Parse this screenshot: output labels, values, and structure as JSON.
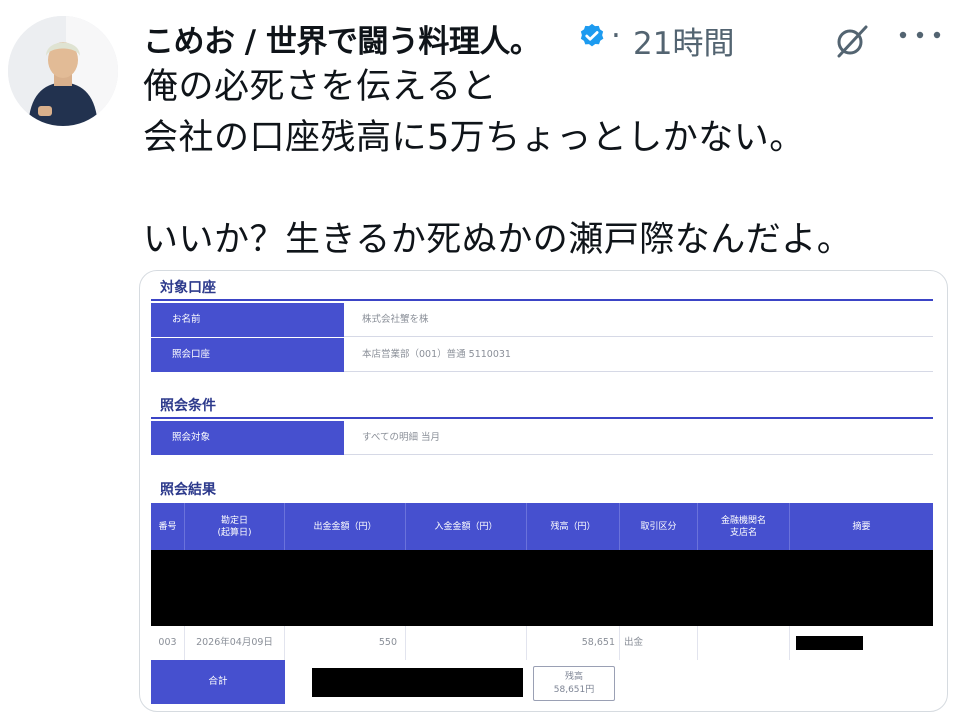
{
  "tweet": {
    "author_name": "こめお / 世界で闘う料理人。",
    "separator": "·",
    "timestamp": "21時間",
    "text": "俺の必死さを伝えると\n会社の口座残高に5万ちょっとしかない。\n\nいいか？生きるか死ぬかの瀬戸際なんだよ。"
  },
  "icons": {
    "avatar": "avatar-photo",
    "verified": "verified-badge-icon",
    "grok": "grok-icon",
    "more": "more-icon"
  },
  "colors": {
    "verified_blue": "#1d9bf0",
    "table_header_blue": "#4650cf",
    "section_title": "#2d3a8c",
    "muted_text": "#536471"
  },
  "statement": {
    "account_section_title": "対象口座",
    "account_rows": [
      {
        "label": "お名前",
        "value": "株式会社蟹を株"
      },
      {
        "label": "照会口座",
        "value": "本店営業部（001）普通 5110031"
      }
    ],
    "conditions_section_title": "照会条件",
    "conditions_rows": [
      {
        "label": "照会対象",
        "value": "すべての明細 当月"
      }
    ],
    "results_section_title": "照会結果",
    "columns": [
      "番号",
      "勘定日\n(起算日)",
      "出金金額（円）",
      "入金金額（円）",
      "残高（円）",
      "取引区分",
      "金融機関名\n支店名",
      "摘要"
    ],
    "row": {
      "number": "003",
      "date": "2026年04月09日",
      "withdrawal": "550",
      "deposit": "",
      "balance": "58,651",
      "type": "出金",
      "bank": "",
      "memo": ""
    },
    "total_label": "合計",
    "balance_label": "残高",
    "balance_value": "58,651円"
  }
}
